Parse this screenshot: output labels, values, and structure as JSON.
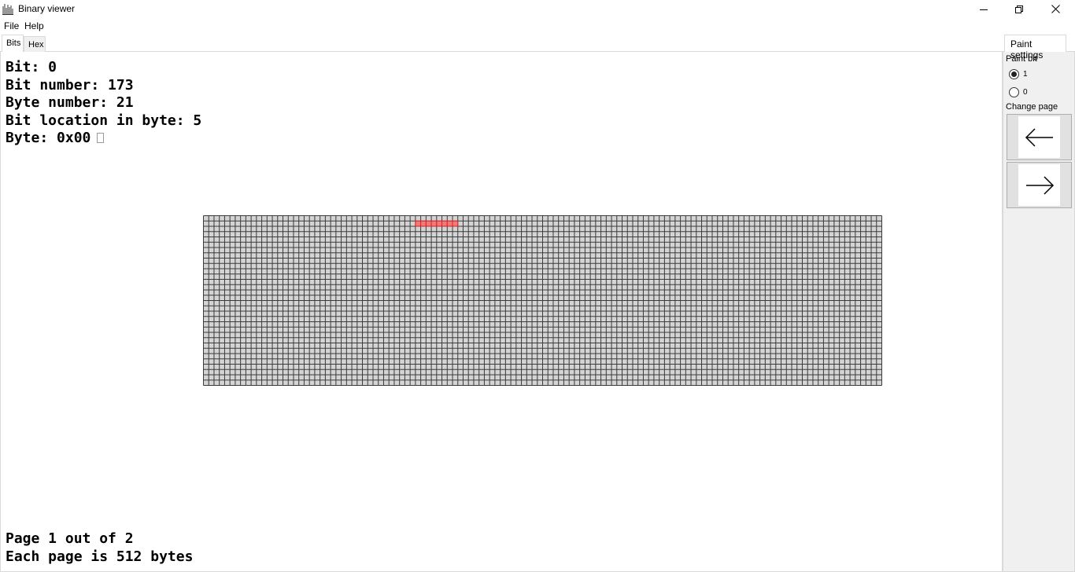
{
  "window": {
    "title": "Binary viewer",
    "controls": [
      "minimize",
      "maximize",
      "close"
    ]
  },
  "menu": {
    "file": "File",
    "help": "Help"
  },
  "tabs": {
    "bits": "Bits",
    "hex": "Hex"
  },
  "info": {
    "bit": "Bit: 0",
    "bit_number": "Bit number: 173",
    "byte_number": "Byte number: 21",
    "bit_location": "Bit location in byte: 5",
    "byte": "Byte: 0x00"
  },
  "footer": {
    "page": "Page 1 out of 2",
    "page_size": "Each page is 512 bytes"
  },
  "grid": {
    "columns": 128,
    "rows": 32,
    "highlighted_bits": [
      168,
      169,
      170,
      171,
      172,
      173,
      174,
      175
    ],
    "cell_color": "#d4d4d4",
    "line_color": "#3a3a3a",
    "highlight_color": "#f07a7a",
    "highlight_line_color": "#e02020"
  },
  "paint_settings": {
    "tab": "Paint settings",
    "paint_bit_label": "Paint bit",
    "options": [
      "1",
      "0"
    ],
    "selected": "1",
    "change_page_label": "Change page",
    "prev_icon": "arrow-left-icon",
    "next_icon": "arrow-right-icon"
  }
}
